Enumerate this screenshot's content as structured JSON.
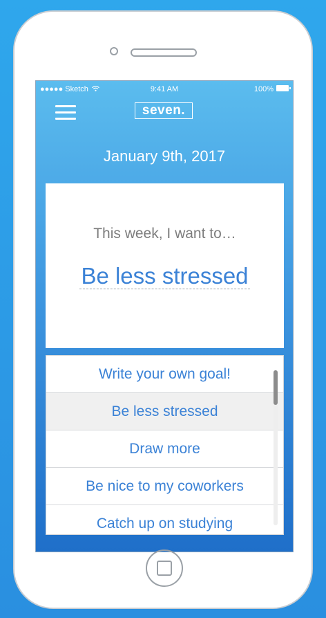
{
  "status_bar": {
    "carrier": "●●●●● Sketch",
    "time": "9:41 AM",
    "battery": "100%"
  },
  "app": {
    "logo": "seven."
  },
  "date": "January 9th, 2017",
  "goal_card": {
    "prompt": "This week, I want to…",
    "selected_goal": "Be less stressed"
  },
  "goal_options": [
    {
      "label": "Write your own goal!"
    },
    {
      "label": "Be less stressed"
    },
    {
      "label": "Draw more"
    },
    {
      "label": "Be nice to my coworkers"
    },
    {
      "label": "Catch up on studying"
    }
  ],
  "colors": {
    "accent": "#3b82d6",
    "screen_top": "#5bbcee",
    "screen_bottom": "#1f6fc9"
  },
  "icons": [
    "menu-icon",
    "wifi-icon",
    "battery-icon",
    "home-button-icon"
  ]
}
